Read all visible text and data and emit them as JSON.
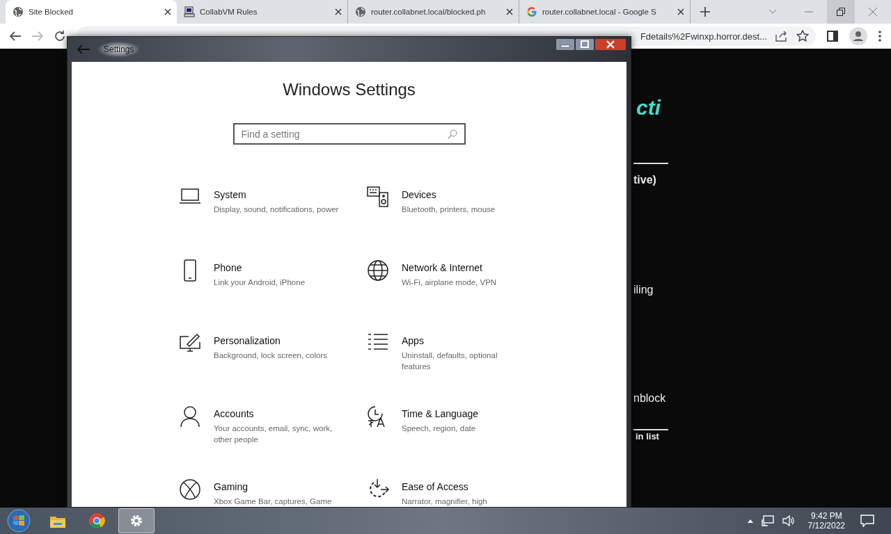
{
  "browser": {
    "tabs": [
      {
        "title": "Site Blocked",
        "selected": true
      },
      {
        "title": "CollabVM Rules",
        "selected": false
      },
      {
        "title": "router.collabnet.local/blocked.ph",
        "selected": false
      },
      {
        "title": "router.collabnet.local - Google S",
        "selected": false
      }
    ],
    "address": "Fdetails%2Fwinxp.horror.dest...",
    "page_fragments": [
      {
        "text": "cti",
        "kind": "heading"
      },
      {
        "text": "tive)",
        "kind": "bold"
      },
      {
        "text": "iling",
        "kind": "text"
      },
      {
        "text": "nblock",
        "kind": "text"
      },
      {
        "text": "in list",
        "kind": "small"
      }
    ]
  },
  "settings_window": {
    "title": "Settings",
    "heading": "Windows Settings",
    "search": {
      "placeholder": "Find a setting"
    },
    "categories": [
      {
        "name": "System",
        "description": "Display, sound, notifications, power"
      },
      {
        "name": "Devices",
        "description": "Bluetooth, printers, mouse"
      },
      {
        "name": "Phone",
        "description": "Link your Android, iPhone"
      },
      {
        "name": "Network & Internet",
        "description": "Wi-Fi, airplane mode, VPN"
      },
      {
        "name": "Personalization",
        "description": "Background, lock screen, colors"
      },
      {
        "name": "Apps",
        "description": "Uninstall, defaults, optional features"
      },
      {
        "name": "Accounts",
        "description": "Your accounts, email, sync, work, other people"
      },
      {
        "name": "Time & Language",
        "description": "Speech, region, date"
      },
      {
        "name": "Gaming",
        "description": "Xbox Game Bar, captures, Game"
      },
      {
        "name": "Ease of Access",
        "description": "Narrator, magnifier, high"
      }
    ]
  },
  "taskbar": {
    "apps": [
      {
        "active": false
      },
      {
        "active": false
      },
      {
        "active": true
      }
    ],
    "time": "9:42 PM",
    "date": "7/12/2022"
  }
}
